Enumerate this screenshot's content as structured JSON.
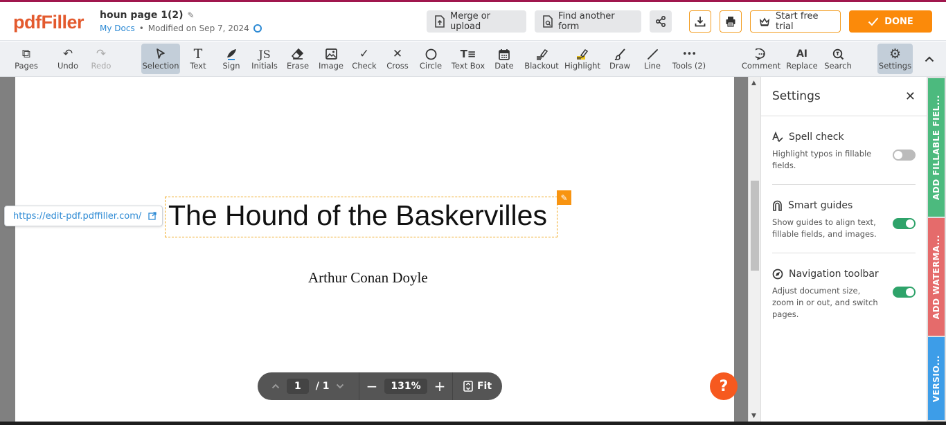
{
  "app": {
    "logo": "pdfFiller"
  },
  "document": {
    "title": "houn page 1(2)",
    "location_link": "My Docs",
    "separator": "•",
    "modified": "Modified on Sep 7, 2024"
  },
  "header": {
    "merge_label": "Merge or upload",
    "find_label": "Find another form",
    "trial_label": "Start free trial",
    "done_label": "DONE"
  },
  "toolbar": {
    "left": [
      {
        "label": "Pages",
        "icon": "pages-icon",
        "glyph": "⧉"
      },
      {
        "label": "Undo",
        "icon": "undo-icon",
        "glyph": "↶"
      },
      {
        "label": "Redo",
        "icon": "redo-icon",
        "glyph": "↷",
        "disabled": true
      }
    ],
    "tools": [
      {
        "label": "Selection",
        "icon": "cursor-icon",
        "glyph": "➤",
        "active": true
      },
      {
        "label": "Text",
        "icon": "text-icon",
        "glyph": "T"
      },
      {
        "label": "Sign",
        "icon": "sign-icon",
        "glyph": "✒"
      },
      {
        "label": "Initials",
        "icon": "initials-icon",
        "glyph": "JS"
      },
      {
        "label": "Erase",
        "icon": "eraser-icon",
        "glyph": "⌫"
      },
      {
        "label": "Image",
        "icon": "image-icon",
        "glyph": "▣"
      },
      {
        "label": "Check",
        "icon": "check-icon",
        "glyph": "✓"
      },
      {
        "label": "Cross",
        "icon": "cross-icon",
        "glyph": "✕"
      },
      {
        "label": "Circle",
        "icon": "circle-icon",
        "glyph": "○"
      },
      {
        "label": "Text Box",
        "icon": "textbox-icon",
        "glyph": "T≡"
      },
      {
        "label": "Date",
        "icon": "calendar-icon",
        "glyph": "▦"
      },
      {
        "label": "Blackout",
        "icon": "blackout-icon",
        "glyph": "✎"
      },
      {
        "label": "Highlight",
        "icon": "highlight-icon",
        "glyph": "✎"
      },
      {
        "label": "Draw",
        "icon": "brush-icon",
        "glyph": "✐"
      },
      {
        "label": "Line",
        "icon": "line-icon",
        "glyph": "╱"
      },
      {
        "label": "Tools (2)",
        "icon": "more-icon",
        "glyph": "•••"
      }
    ],
    "right": [
      {
        "label": "Comment",
        "icon": "comment-icon",
        "glyph": "💬"
      },
      {
        "label": "Replace",
        "icon": "replace-icon",
        "glyph": "AI"
      },
      {
        "label": "Search",
        "icon": "search-icon",
        "glyph": "⌕"
      },
      {
        "label": "Settings",
        "icon": "gear-icon",
        "glyph": "⚙",
        "active": true
      }
    ],
    "collapse_glyph": "⌃"
  },
  "page": {
    "title_text": "The Hound of the Baskervilles",
    "author": "Arthur Conan Doyle",
    "url_chip": "https://edit-pdf.pdffiller.com/"
  },
  "nav": {
    "current_page": "1",
    "total_pages": "/ 1",
    "zoom": "131%",
    "fit_label": "Fit"
  },
  "help": {
    "label": "?"
  },
  "settings": {
    "title": "Settings",
    "items": [
      {
        "title": "Spell check",
        "desc": "Highlight typos in fillable fields.",
        "enabled": false
      },
      {
        "title": "Smart guides",
        "desc": "Show guides to align text, fillable fields, and images.",
        "enabled": true
      },
      {
        "title": "Navigation toolbar",
        "desc": "Adjust document size, zoom in or out, and switch pages.",
        "enabled": true
      }
    ]
  },
  "side_tabs": [
    {
      "label": "ADD FILLABLE FIEL...",
      "color": "#4cba7e"
    },
    {
      "label": "ADD WATERMA...",
      "color": "#e56b6b"
    },
    {
      "label": "VERSIO...",
      "color": "#3d9de8"
    }
  ],
  "colors": {
    "brand": "#e35a2e",
    "accent": "#fb8a0a",
    "link": "#2d8ad4",
    "toggle_on": "#2ea36a"
  }
}
